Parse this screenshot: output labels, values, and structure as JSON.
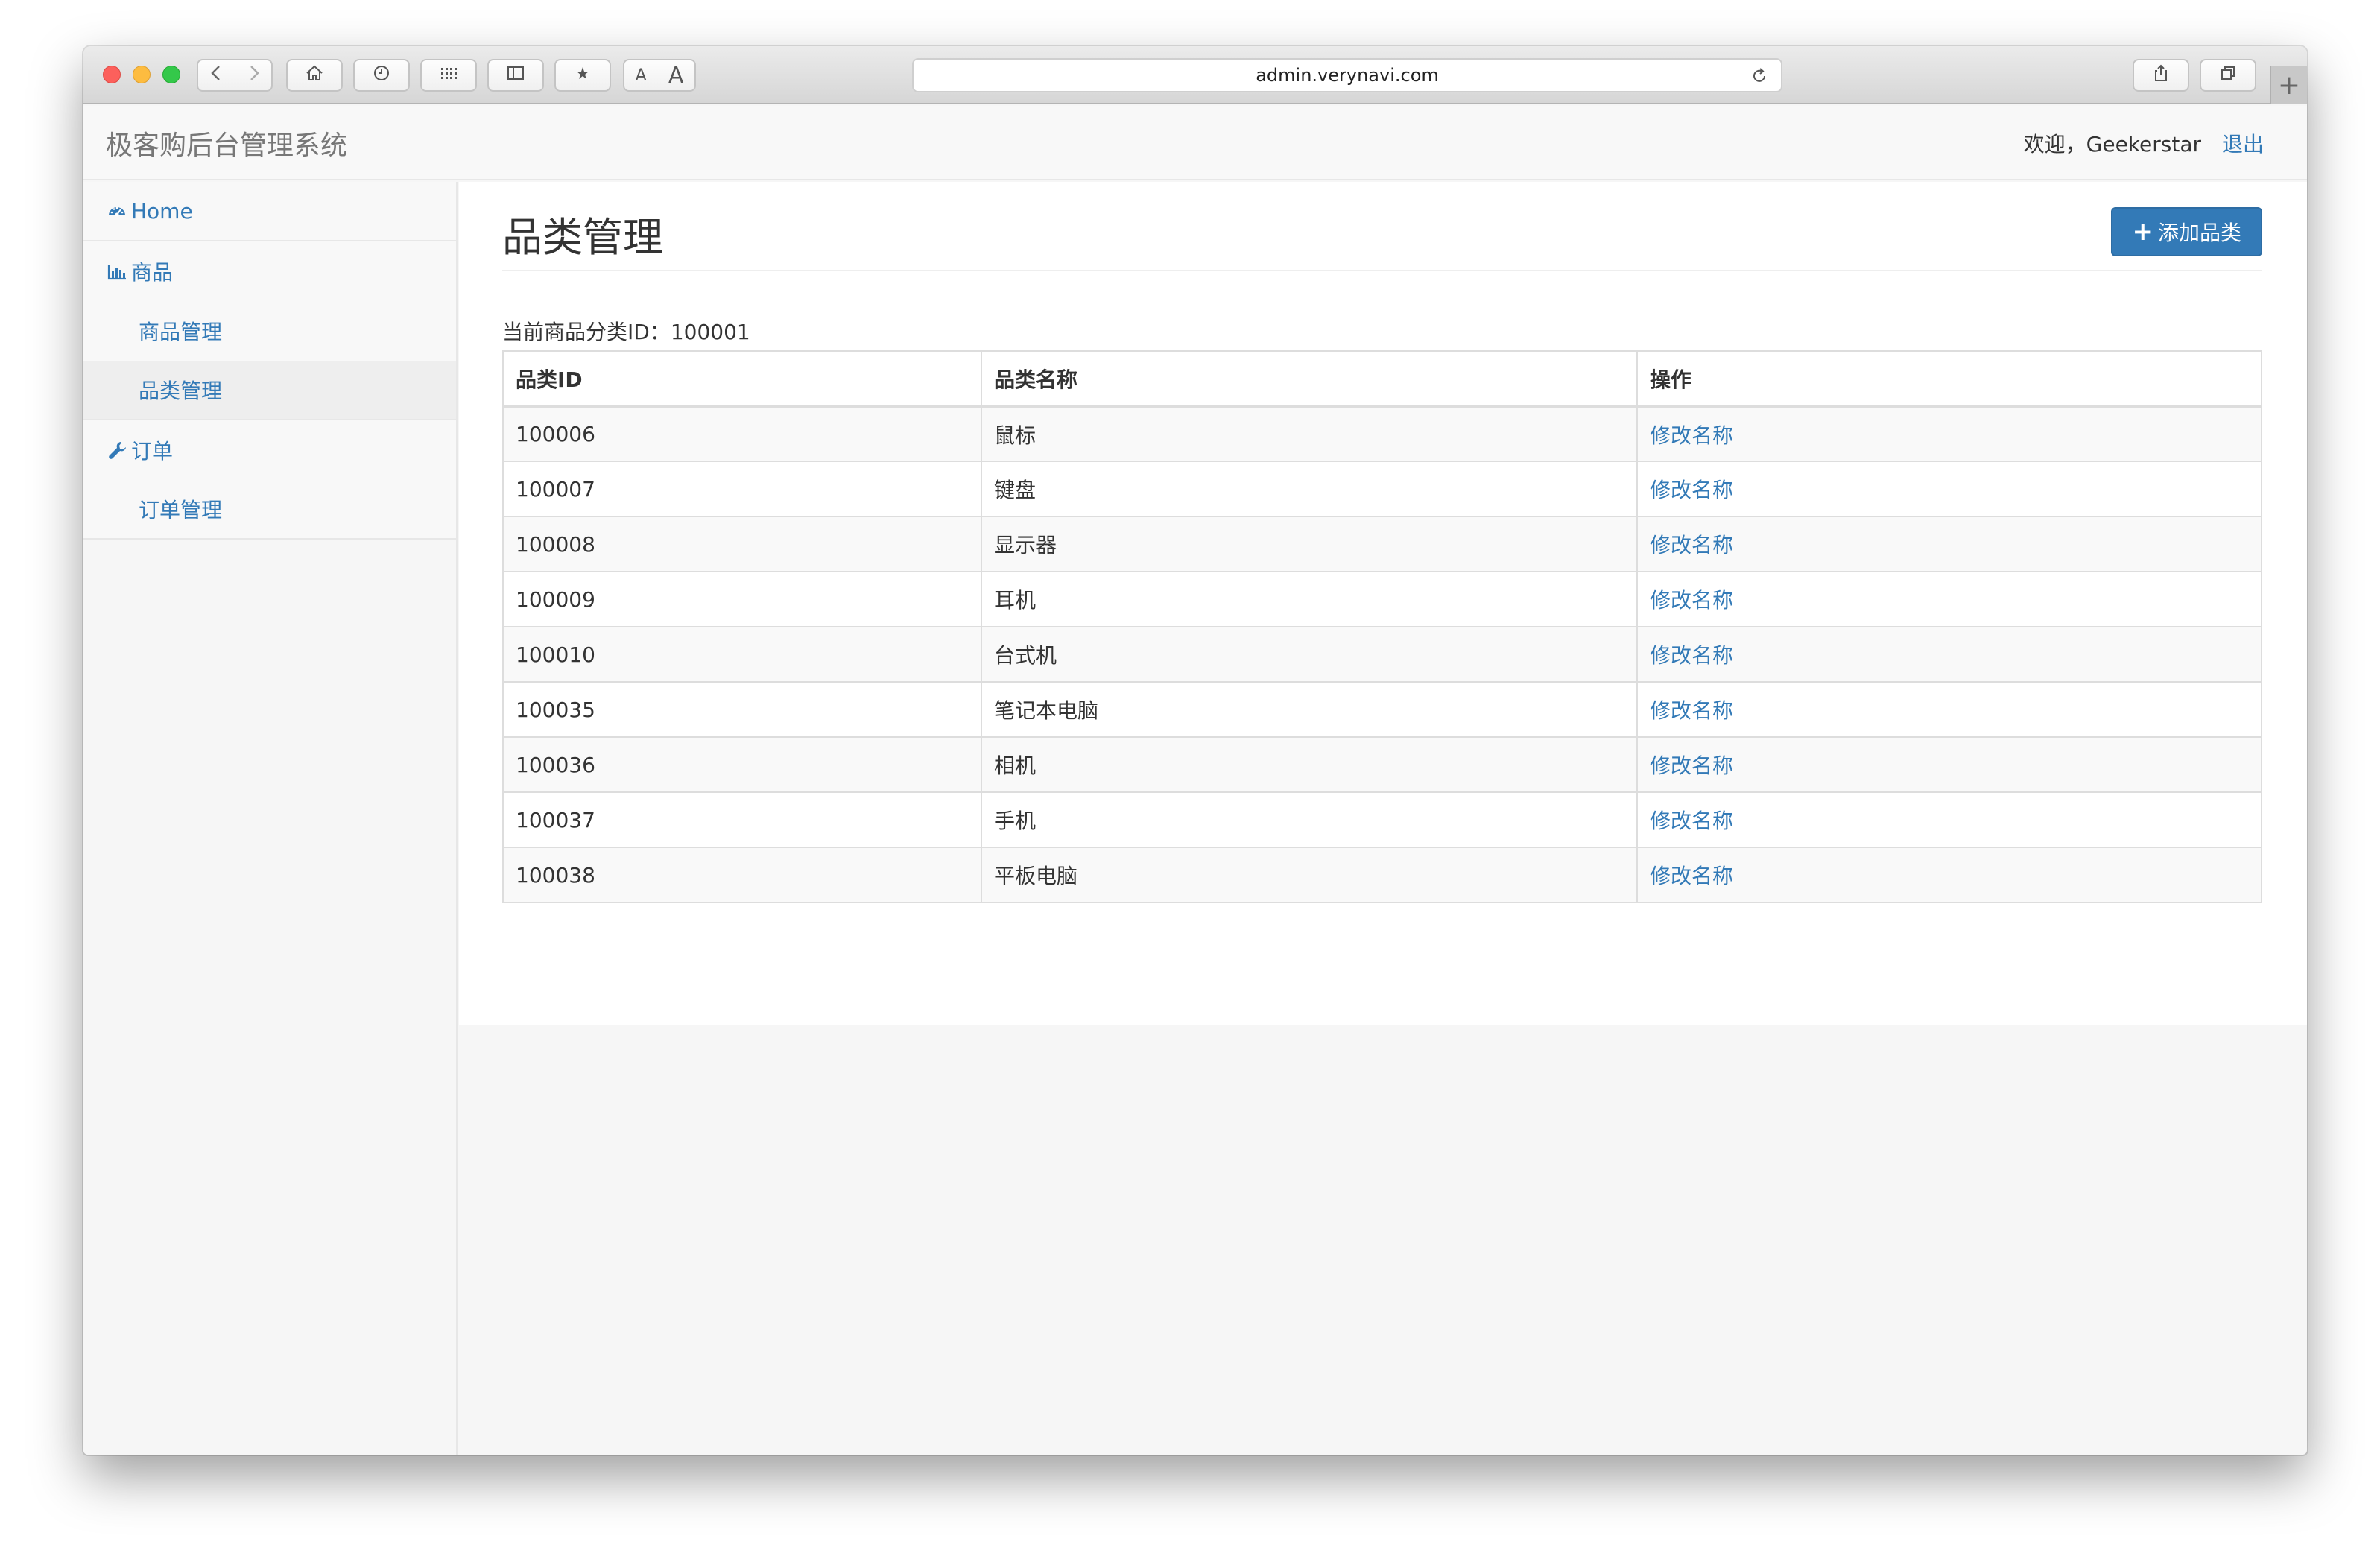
{
  "browser": {
    "url": "admin.verynavi.com",
    "new_tab_label": "+",
    "font_small_label": "A",
    "font_large_label": "A"
  },
  "header": {
    "brand": "极客购后台管理系统",
    "welcome": "欢迎，Geekerstar",
    "logout": "退出"
  },
  "sidebar": {
    "home": "Home",
    "product_group": "商品",
    "product_manage": "商品管理",
    "category_manage": "品类管理",
    "order_group": "订单",
    "order_manage": "订单管理"
  },
  "page": {
    "title": "品类管理",
    "add_button": "添加品类",
    "current_label": "当前商品分类ID：",
    "current_id": "100001"
  },
  "table": {
    "headers": [
      "品类ID",
      "品类名称",
      "操作"
    ],
    "rows": [
      {
        "id": "100006",
        "name": "鼠标",
        "action": "修改名称"
      },
      {
        "id": "100007",
        "name": "键盘",
        "action": "修改名称"
      },
      {
        "id": "100008",
        "name": "显示器",
        "action": "修改名称"
      },
      {
        "id": "100009",
        "name": "耳机",
        "action": "修改名称"
      },
      {
        "id": "100010",
        "name": "台式机",
        "action": "修改名称"
      },
      {
        "id": "100035",
        "name": "笔记本电脑",
        "action": "修改名称"
      },
      {
        "id": "100036",
        "name": "相机",
        "action": "修改名称"
      },
      {
        "id": "100037",
        "name": "手机",
        "action": "修改名称"
      },
      {
        "id": "100038",
        "name": "平板电脑",
        "action": "修改名称"
      }
    ]
  },
  "colors": {
    "link": "#337ab7",
    "primary_button": "#337ab7",
    "active_sidebar": "#eeeeee"
  }
}
